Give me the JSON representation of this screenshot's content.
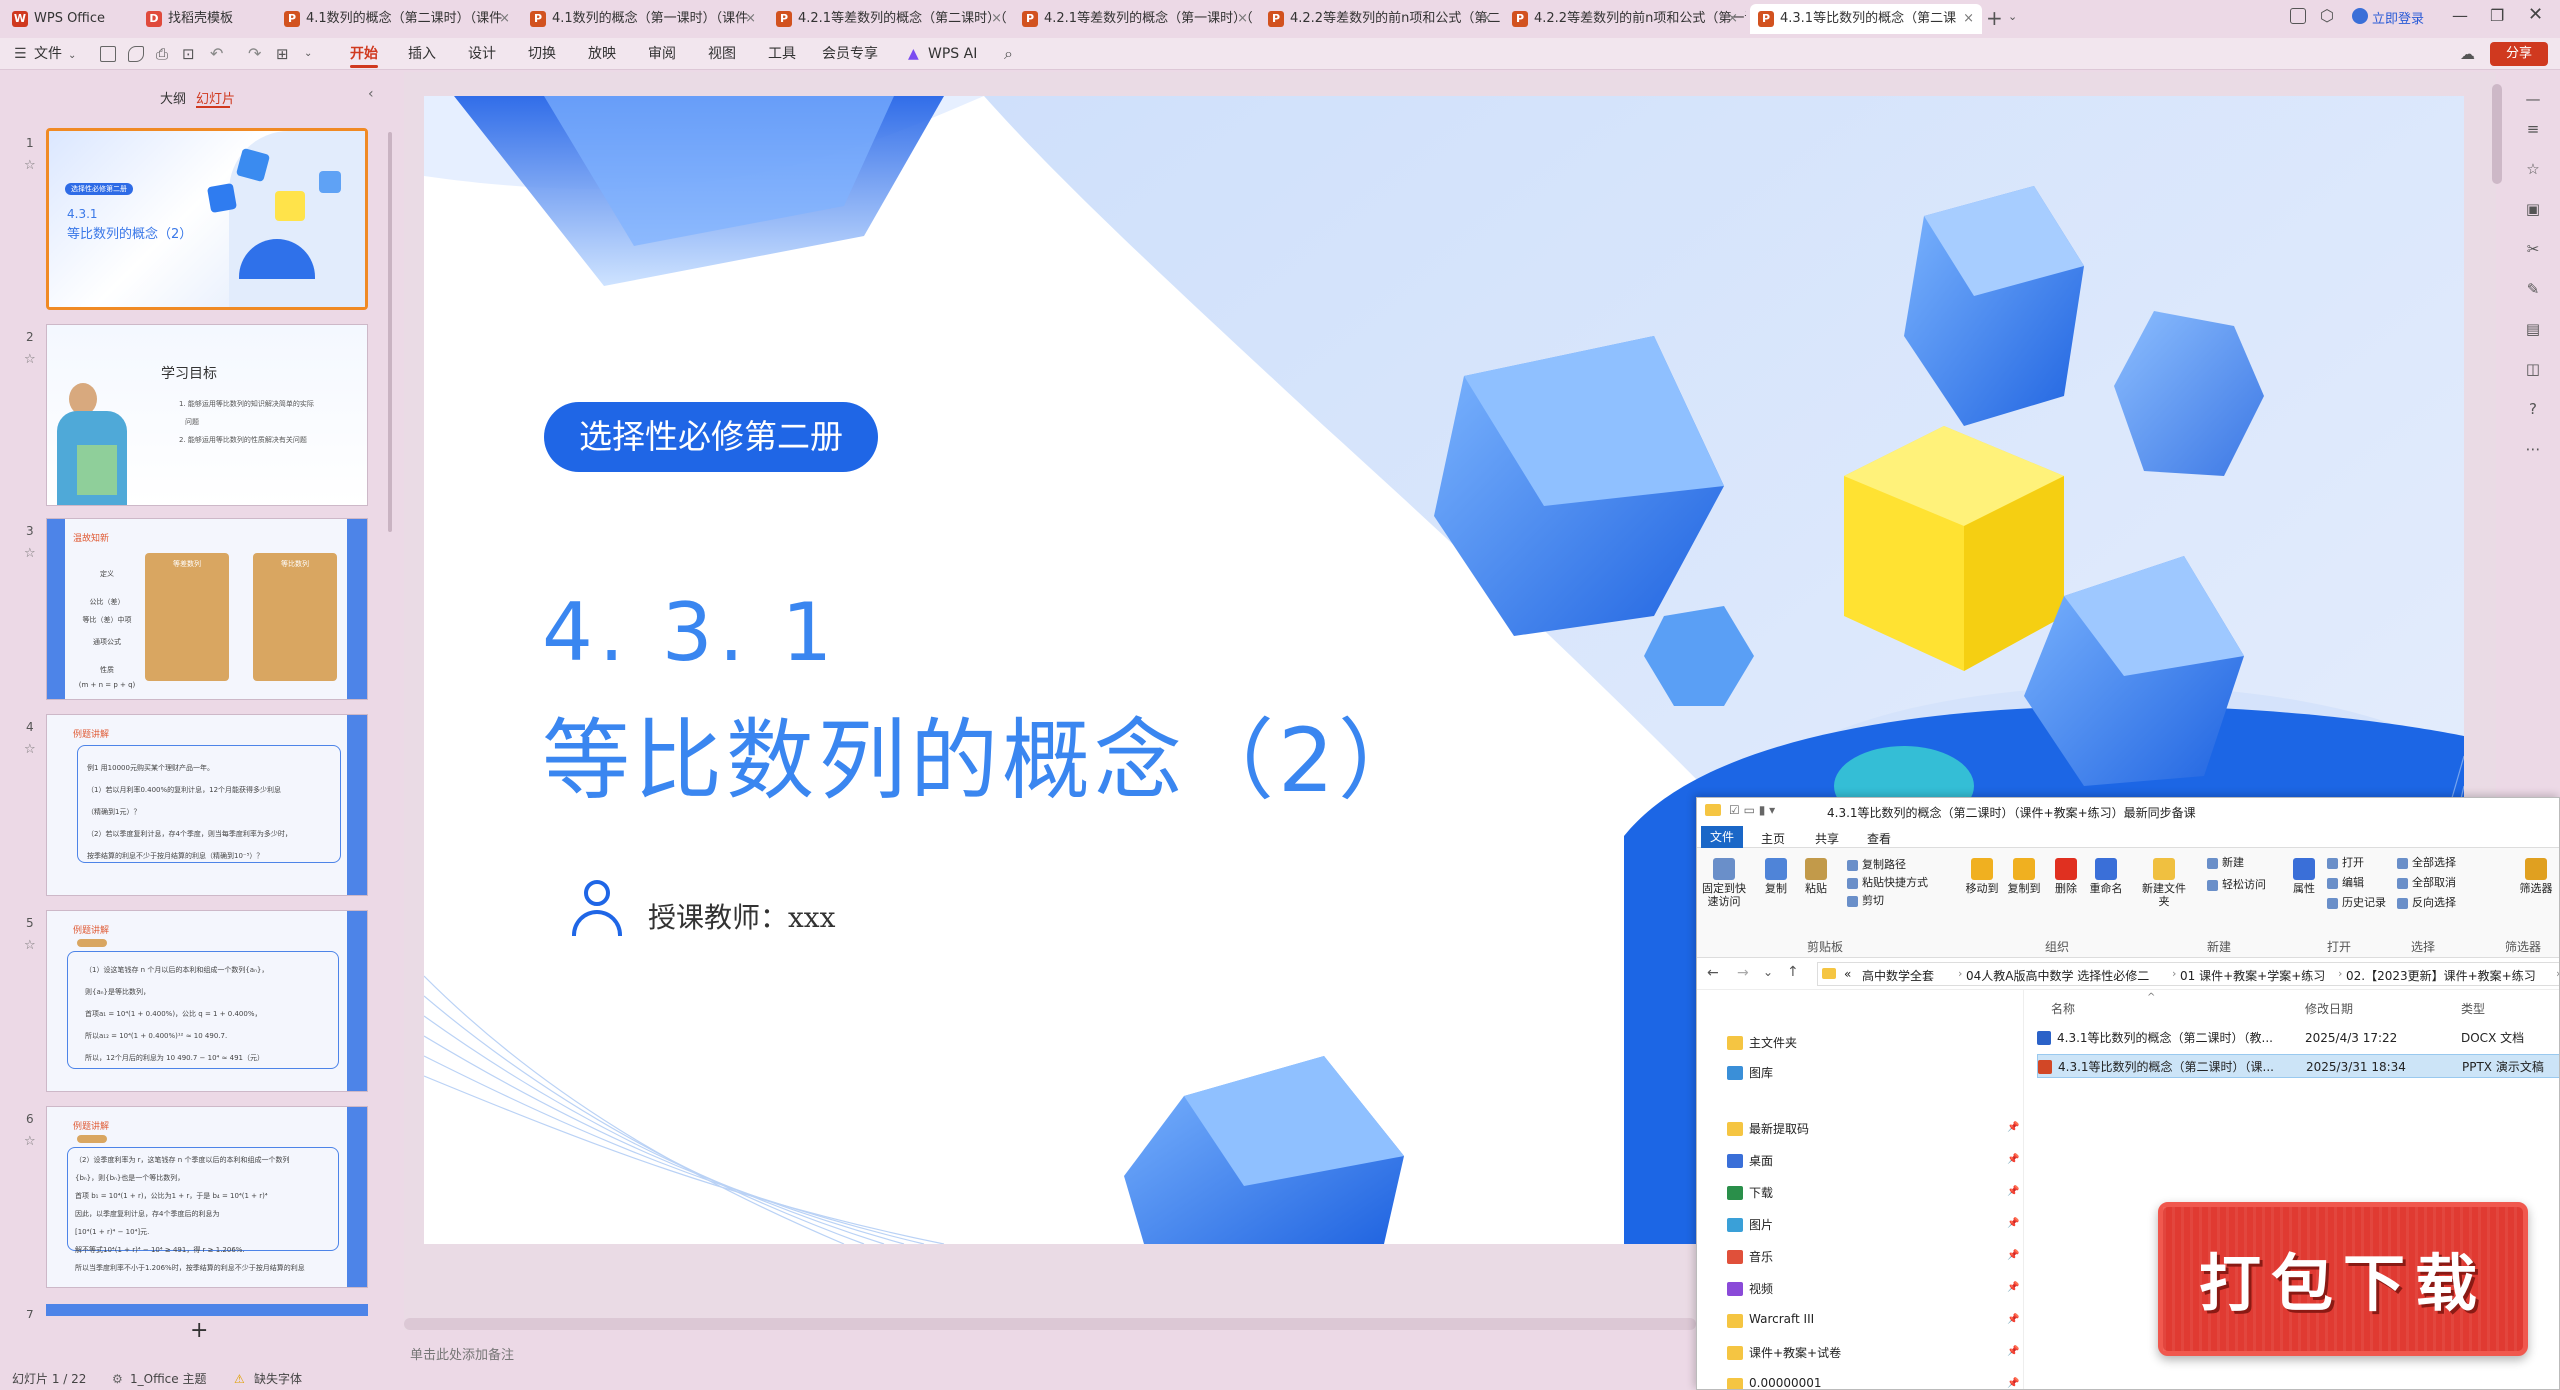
{
  "tabs": [
    {
      "label": "WPS Office",
      "icon": "W",
      "color": "#d0391f"
    },
    {
      "label": "找稻壳模板",
      "icon": "D",
      "color": "#e04a3c"
    },
    {
      "label": "4.1数列的概念（第二课时）（课件",
      "icon": "P",
      "color": "#d2521f"
    },
    {
      "label": "4.1数列的概念（第一课时）（课件",
      "icon": "P",
      "color": "#d2521f"
    },
    {
      "label": "4.2.1等差数列的概念（第二课时）（",
      "icon": "P",
      "color": "#d2521f"
    },
    {
      "label": "4.2.1等差数列的概念（第一课时）（",
      "icon": "P",
      "color": "#d2521f"
    },
    {
      "label": "4.2.2等差数列的前n项和公式（第二课",
      "icon": "P",
      "color": "#d2521f"
    },
    {
      "label": "4.2.2等差数列的前n项和公式（第一课",
      "icon": "P",
      "color": "#d2521f"
    },
    {
      "label": "4.3.1等比数列的概念（第二课",
      "icon": "P",
      "color": "#d2521f"
    }
  ],
  "login": "立即登录",
  "share": "分享",
  "menus": [
    "文件",
    "开始",
    "插入",
    "设计",
    "切换",
    "放映",
    "审阅",
    "视图",
    "工具",
    "会员专享",
    "WPS AI"
  ],
  "panel": {
    "outline": "大纲",
    "slides": "幻灯片",
    "add": "+"
  },
  "thumbs": [
    {
      "n": "1",
      "title": "4.3.1",
      "sub": "等比数列的概念（2）",
      "tag": "选择性必修第二册"
    },
    {
      "n": "2",
      "title": "学习目标",
      "lines": [
        "1. 能够运用等比数列的知识解决简单的实际",
        "问题",
        "2. 能够运用等比数列的性质解决有关问题"
      ]
    },
    {
      "n": "3",
      "title": "温故知新",
      "card1": "等差数列",
      "card2": "等比数列",
      "rows": [
        "定义",
        "公比（差）",
        "等比（差）中项",
        "通项公式",
        "性质",
        "(m + n = p + q)"
      ]
    },
    {
      "n": "4",
      "title": "例题讲解",
      "lines": [
        "例1 用10000元购买某个理财产品一年。",
        "（1）若以月利率0.400%的复利计息，12个月能获得多少利息",
        "（精确到1元）？",
        "（2）若以季度复利计息，存4个季度，则当每季度利率为多少时，",
        "按季结算的利息不少于按月结算的利息（精确到10⁻⁵）？"
      ]
    },
    {
      "n": "5",
      "title": "例题讲解",
      "lines": [
        "（1）设这笔钱存 n 个月以后的本利和组成一个数列{aₙ}，",
        "则{aₙ}是等比数列，",
        "首项a₁ = 10⁴(1 + 0.400%)，公比 q = 1 + 0.400%，",
        "所以a₁₂ = 10⁴(1 + 0.400%)¹² ≈ 10 490.7.",
        "所以，12个月后的利息为 10 490.7 − 10⁴ ≈ 491（元）"
      ]
    },
    {
      "n": "6",
      "title": "例题讲解",
      "lines": [
        "（2）设季度利率为 r，这笔钱存 n 个季度以后的本利和组成一个数列",
        "{bₙ}，则{bₙ}也是一个等比数列，",
        "首项 b₁ = 10⁴(1 + r)，公比为1 + r，于是 b₄ = 10⁴(1 + r)⁴",
        "因此，以季度复利计息，存4个季度后的利息为",
        "[10⁴(1 + r)⁴ − 10⁴]元.",
        "解不等式10⁴(1 + r)⁴ − 10⁴ ≥ 491，得 r ≥ 1.206%.",
        "所以当季度利率不小于1.206%时，按季结算的利息不少于按月结算的利息"
      ]
    },
    {
      "n": "7"
    }
  ],
  "slide": {
    "badge": "选择性必修第二册",
    "number": "4. 3. 1",
    "title": "等比数列的概念（2）",
    "teacher": "授课教师：xxx"
  },
  "notes": "单击此处添加备注",
  "status": {
    "page": "幻灯片 1 / 22",
    "theme": "1_Office 主题",
    "font": "缺失字体"
  },
  "explorer": {
    "title": "4.3.1等比数列的概念（第二课时）（课件+教案+练习）最新同步备课",
    "tabs": [
      "文件",
      "主页",
      "共享",
      "查看"
    ],
    "ribbon": [
      "固定到快速访问",
      "复制",
      "粘贴",
      "复制路径",
      "粘贴快捷方式",
      "剪切",
      "移动到",
      "复制到",
      "删除",
      "重命名",
      "新建文件夹",
      "新建",
      "轻松访问",
      "属性",
      "打开",
      "编辑",
      "历史记录",
      "全部选择",
      "全部取消",
      "反向选择",
      "筛选器"
    ],
    "groups": [
      "剪贴板",
      "组织",
      "新建",
      "打开",
      "选择",
      "筛选器"
    ],
    "path": [
      "«",
      "高中数学全套",
      "04人教A版高中数学 选择性必修二",
      "01 课件+教案+学案+练习",
      "02.【2023更新】课件+教案+练习"
    ],
    "nav": [
      "主文件夹",
      "图库",
      "最新提取码",
      "桌面",
      "下载",
      "图片",
      "音乐",
      "视频",
      "Warcraft III",
      "课件+教案+试卷",
      "0.00000001"
    ],
    "columns": [
      "名称",
      "修改日期",
      "类型"
    ],
    "files": [
      {
        "name": "4.3.1等比数列的概念（第二课时）（教...",
        "date": "2025/4/3 17:22",
        "type": "DOCX 文档"
      },
      {
        "name": "4.3.1等比数列的概念（第二课时）（课...",
        "date": "2025/3/31 18:34",
        "type": "PPTX 演示文稿"
      }
    ]
  },
  "banner": "打包下载"
}
